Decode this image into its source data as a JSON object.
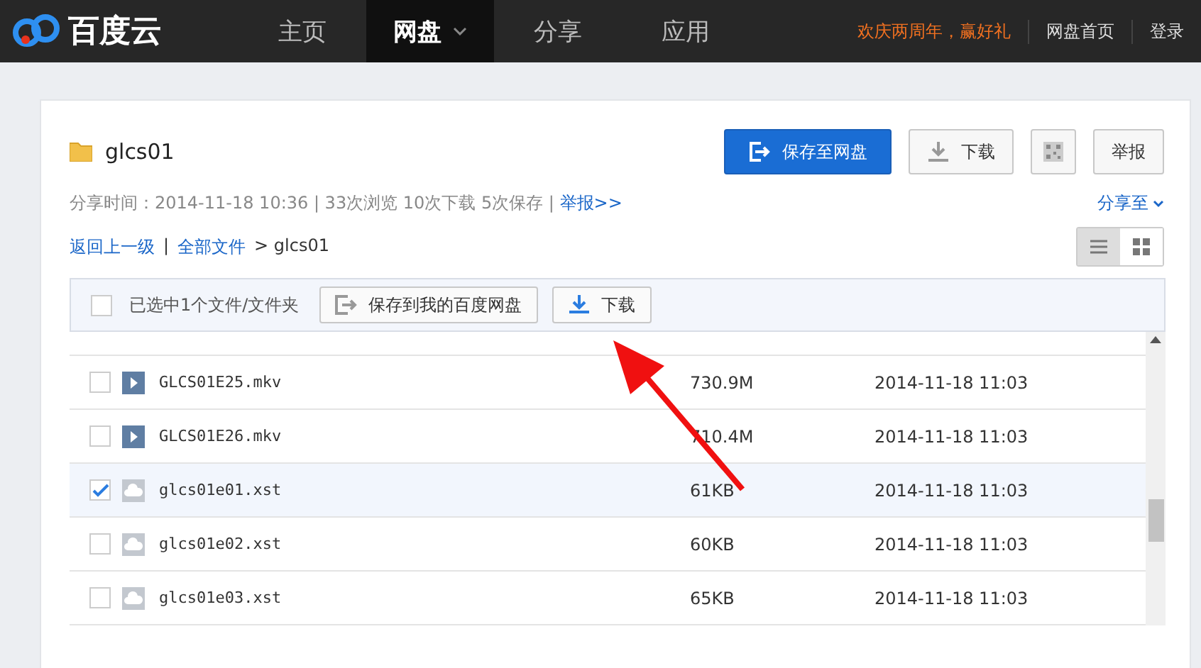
{
  "nav": {
    "logo": "百度云",
    "items": [
      {
        "label": "主页",
        "selected": false,
        "dropdown": false
      },
      {
        "label": "网盘",
        "selected": true,
        "dropdown": true
      },
      {
        "label": "分享",
        "selected": false,
        "dropdown": false
      },
      {
        "label": "应用",
        "selected": false,
        "dropdown": false
      }
    ],
    "promo": "欢庆两周年，赢好礼",
    "links": [
      "网盘首页",
      "登录"
    ]
  },
  "share": {
    "folder": "glcs01",
    "save_button": "保存至网盘",
    "download_button": "下载",
    "report_button": "举报",
    "meta": "分享时间：2014-11-18 10:36 | 33次浏览 10次下载 5次保存 |",
    "report_link": "举报>>",
    "share_to": "分享至",
    "breadcrumb": {
      "back": "返回上一级",
      "separator": "|",
      "all": "全部文件",
      "current": "> glcs01"
    },
    "views": [
      {
        "kind": "list",
        "selected": true
      },
      {
        "kind": "grid",
        "selected": false
      }
    ]
  },
  "toolbar": {
    "checked": false,
    "selection": "已选中1个文件/文件夹",
    "save_button": "保存到我的百度网盘",
    "download_button": "下载"
  },
  "files": [
    {
      "kind": "video",
      "name": "GLCS01E25.mkv",
      "size": "730.9M",
      "date": "2014-11-18 11:03",
      "checked": false
    },
    {
      "kind": "video",
      "name": "GLCS01E26.mkv",
      "size": "710.4M",
      "date": "2014-11-18 11:03",
      "checked": false
    },
    {
      "kind": "cloud",
      "name": "glcs01e01.xst",
      "size": "61KB",
      "date": "2014-11-18 11:03",
      "checked": true
    },
    {
      "kind": "cloud",
      "name": "glcs01e02.xst",
      "size": "60KB",
      "date": "2014-11-18 11:03",
      "checked": false
    },
    {
      "kind": "cloud",
      "name": "glcs01e03.xst",
      "size": "65KB",
      "date": "2014-11-18 11:03",
      "checked": false
    }
  ]
}
